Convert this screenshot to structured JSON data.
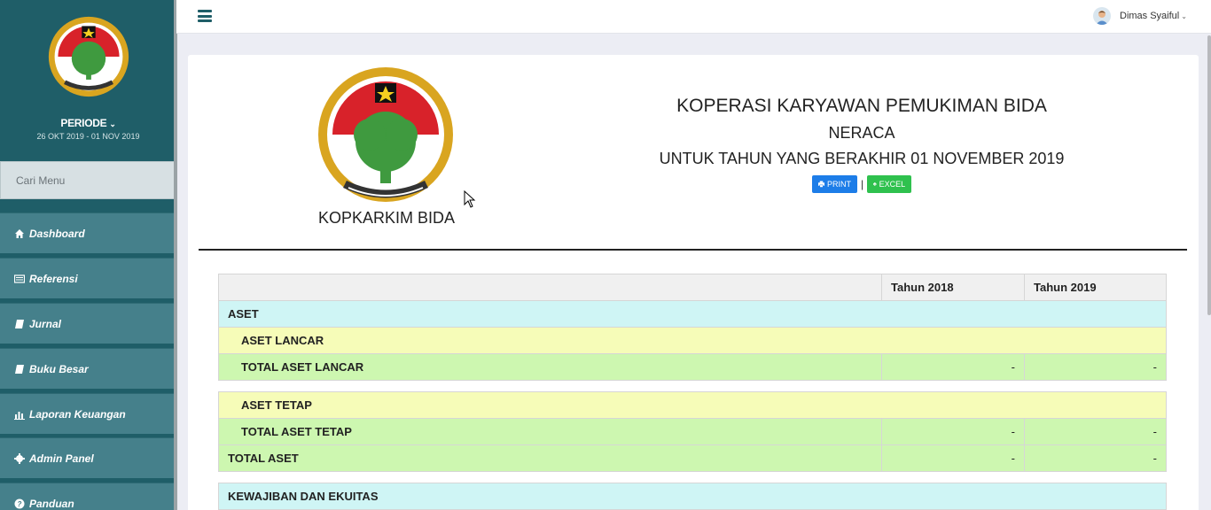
{
  "sidebar": {
    "periode_label": "PERIODE",
    "periode_range": "26 OKT 2019 - 01 NOV 2019",
    "search_placeholder": "Cari Menu",
    "items": [
      {
        "label": "Dashboard",
        "icon": "home-icon"
      },
      {
        "label": "Referensi",
        "icon": "list-icon"
      },
      {
        "label": "Jurnal",
        "icon": "book-icon"
      },
      {
        "label": "Buku Besar",
        "icon": "book-icon"
      },
      {
        "label": "Laporan Keuangan",
        "icon": "bar-chart-icon"
      },
      {
        "label": "Admin Panel",
        "icon": "gear-icon"
      },
      {
        "label": "Panduan",
        "icon": "question-icon"
      }
    ]
  },
  "topbar": {
    "username": "Dimas Syaiful"
  },
  "report": {
    "brand_name": "KOPKARKIM BIDA",
    "org_name": "KOPERASI KARYAWAN PEMUKIMAN BIDA",
    "title": "NERACA",
    "period": "UNTUK TAHUN YANG BERAKHIR 01 NOVEMBER 2019",
    "print_label": "PRINT",
    "excel_label": "EXCEL",
    "separator": "|"
  },
  "table": {
    "headers": [
      "",
      "Tahun 2018",
      "Tahun 2019"
    ],
    "aset_header": "ASET",
    "aset_lancar": "ASET LANCAR",
    "total_aset_lancar": {
      "label": "TOTAL ASET LANCAR",
      "y2018": "-",
      "y2019": "-"
    },
    "aset_tetap": "ASET TETAP",
    "total_aset_tetap": {
      "label": "TOTAL ASET TETAP",
      "y2018": "-",
      "y2019": "-"
    },
    "total_aset": {
      "label": "TOTAL ASET",
      "y2018": "-",
      "y2019": "-"
    },
    "kewajiban_header": "KEWAJIBAN DAN EKUITAS"
  },
  "colors": {
    "sidebar_bg": "#1f5e68",
    "menu_bg": "#45808b",
    "print_btn": "#1d7de8",
    "excel_btn": "#2fc14e",
    "row_cyan": "#cff5f5",
    "row_yellow": "#f6fcb8",
    "row_green": "#cdf7b0"
  }
}
